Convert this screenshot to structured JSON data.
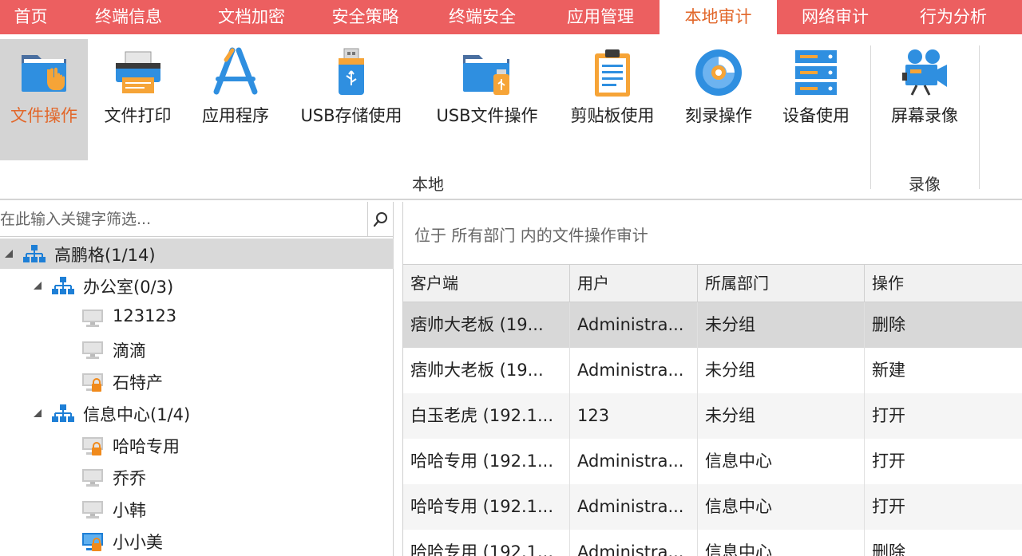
{
  "tabs": [
    {
      "label": "首页"
    },
    {
      "label": "终端信息"
    },
    {
      "label": "文档加密"
    },
    {
      "label": "安全策略"
    },
    {
      "label": "终端安全"
    },
    {
      "label": "应用管理"
    },
    {
      "label": "本地审计"
    },
    {
      "label": "网络审计"
    },
    {
      "label": "行为分析"
    }
  ],
  "active_tab": "本地审计",
  "ribbon": {
    "buttons": [
      {
        "label": "文件操作",
        "icon": "folder-hand-icon"
      },
      {
        "label": "文件打印",
        "icon": "printer-icon"
      },
      {
        "label": "应用程序",
        "icon": "app-store-icon"
      },
      {
        "label": "USB存储使用",
        "icon": "usb-drive-icon"
      },
      {
        "label": "USB文件操作",
        "icon": "folder-usb-icon"
      },
      {
        "label": "剪贴板使用",
        "icon": "clipboard-icon"
      },
      {
        "label": "刻录操作",
        "icon": "disc-icon"
      },
      {
        "label": "设备使用",
        "icon": "server-icon"
      },
      {
        "label": "屏幕录像",
        "icon": "video-camera-icon"
      }
    ],
    "groups": [
      {
        "label": "本地"
      },
      {
        "label": "录像"
      }
    ]
  },
  "search": {
    "placeholder": "在此输入关键字筛选..."
  },
  "tree": [
    {
      "label": "高鹏格(1/14)",
      "type": "org",
      "level": 0,
      "expanded": true,
      "selected": true
    },
    {
      "label": "办公室(0/3)",
      "type": "org",
      "level": 1,
      "expanded": true
    },
    {
      "label": "123123",
      "type": "pc",
      "level": 2
    },
    {
      "label": "滴滴",
      "type": "pc",
      "level": 2
    },
    {
      "label": "石特产",
      "type": "pc-locked",
      "level": 2
    },
    {
      "label": "信息中心(1/4)",
      "type": "org",
      "level": 1,
      "expanded": true
    },
    {
      "label": "哈哈专用",
      "type": "pc-locked",
      "level": 2
    },
    {
      "label": "乔乔",
      "type": "pc",
      "level": 2
    },
    {
      "label": "小韩",
      "type": "pc",
      "level": 2
    },
    {
      "label": "小小美",
      "type": "pc-online-locked",
      "level": 2
    }
  ],
  "location_text": "位于 所有部门 内的文件操作审计",
  "table": {
    "columns": [
      "客户端",
      "用户",
      "所属部门",
      "操作"
    ],
    "rows": [
      [
        "痞帅大老板 (19...",
        "Administra...",
        "未分组",
        "删除"
      ],
      [
        "痞帅大老板 (19...",
        "Administra...",
        "未分组",
        "新建"
      ],
      [
        "白玉老虎 (192.1...",
        "123",
        "未分组",
        "打开"
      ],
      [
        "哈哈专用 (192.1...",
        "Administra...",
        "信息中心",
        "打开"
      ],
      [
        "哈哈专用 (192.1...",
        "Administra...",
        "信息中心",
        "打开"
      ],
      [
        "哈哈专用 (192.1...",
        "Administra...",
        "信息中心",
        "删除"
      ]
    ]
  },
  "colors": {
    "tabbar": "#ec5f60",
    "active_text": "#e2672a",
    "org_icon": "#1e7fd6",
    "lock": "#f08a1c"
  }
}
